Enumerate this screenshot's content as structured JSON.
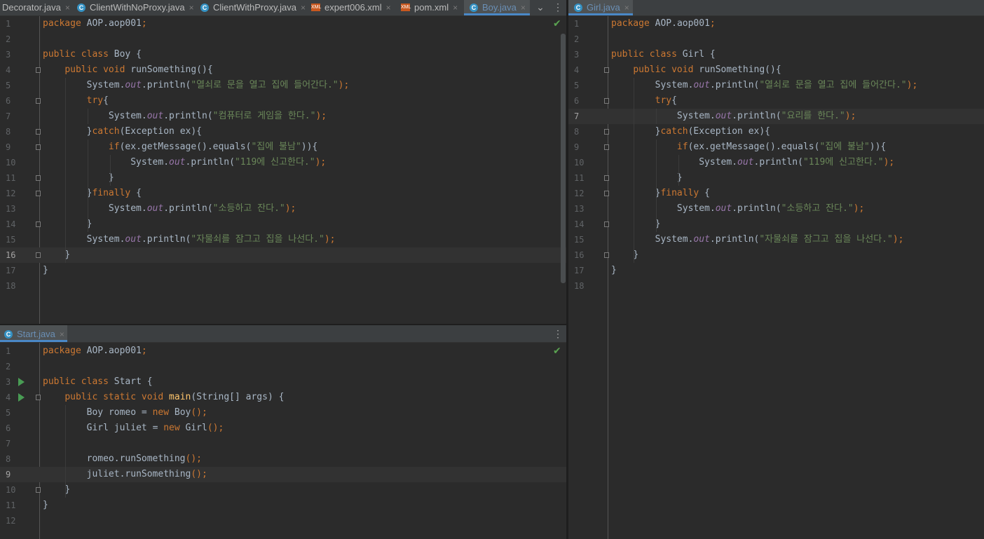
{
  "top_left_tabs": [
    {
      "label": "Decorator.java",
      "icon": "none"
    },
    {
      "label": "ClientWithNoProxy.java",
      "icon": "class-icon"
    },
    {
      "label": "ClientWithProxy.java",
      "icon": "class-icon"
    },
    {
      "label": "expert006.xml",
      "icon": "xml-icon"
    },
    {
      "label": "pom.xml",
      "icon": "xml-icon"
    },
    {
      "label": "Boy.java",
      "icon": "class-icon",
      "active": true
    }
  ],
  "right_tabs": [
    {
      "label": "Girl.java",
      "icon": "class-icon",
      "active": true
    }
  ],
  "bottom_tabs": [
    {
      "label": "Start.java",
      "icon": "class-icon",
      "active": true
    }
  ],
  "tab_close": "×",
  "tab_more": "⋮",
  "tab_dropdown": "⌄",
  "check_mark": "✔",
  "icon_letter": "C",
  "xml_badge": "XML",
  "colors": {
    "background": "#2b2b2b",
    "keyword": "#cc7832",
    "function": "#ffc66d",
    "string": "#6a8759",
    "field": "#9876aa",
    "text": "#a9b7c6",
    "active_tab_accent": "#4a88c7",
    "ok_check": "#5aa351"
  },
  "boy_editor": {
    "current_line": 16,
    "lines": [
      "package AOP.aop001;",
      "",
      "public class Boy {",
      "    public void runSomething(){",
      "        System.out.println(\"열쇠로 문을 열고 집에 들어간다.\");",
      "        try{",
      "            System.out.println(\"컴퓨터로 게임을 한다.\");",
      "        }catch(Exception ex){",
      "            if(ex.getMessage().equals(\"집에 불남\")){",
      "                System.out.println(\"119에 신고한다.\");",
      "            }",
      "        }finally {",
      "            System.out.println(\"소등하고 잔다.\");",
      "        }",
      "        System.out.println(\"자물쇠를 잠그고 집을 나선다.\");",
      "    }",
      "}",
      ""
    ]
  },
  "girl_editor": {
    "current_line": 7,
    "lines": [
      "package AOP.aop001;",
      "",
      "public class Girl {",
      "    public void runSomething(){",
      "        System.out.println(\"열쇠로 문을 열고 집에 들어간다.\");",
      "        try{",
      "            System.out.println(\"요리를 한다.\");",
      "        }catch(Exception ex){",
      "            if(ex.getMessage().equals(\"집에 불남\")){",
      "                System.out.println(\"119에 신고한다.\");",
      "            }",
      "        }finally {",
      "            System.out.println(\"소등하고 잔다.\");",
      "        }",
      "        System.out.println(\"자물쇠를 잠그고 집을 나선다.\");",
      "    }",
      "}",
      ""
    ]
  },
  "start_editor": {
    "current_line": 9,
    "lines": [
      "package AOP.aop001;",
      "",
      "public class Start {",
      "    public static void main(String[] args) {",
      "        Boy romeo = new Boy();",
      "        Girl juliet = new Girl();",
      "",
      "        romeo.runSomething();",
      "        juliet.runSomething();",
      "    }",
      "}",
      ""
    ]
  }
}
